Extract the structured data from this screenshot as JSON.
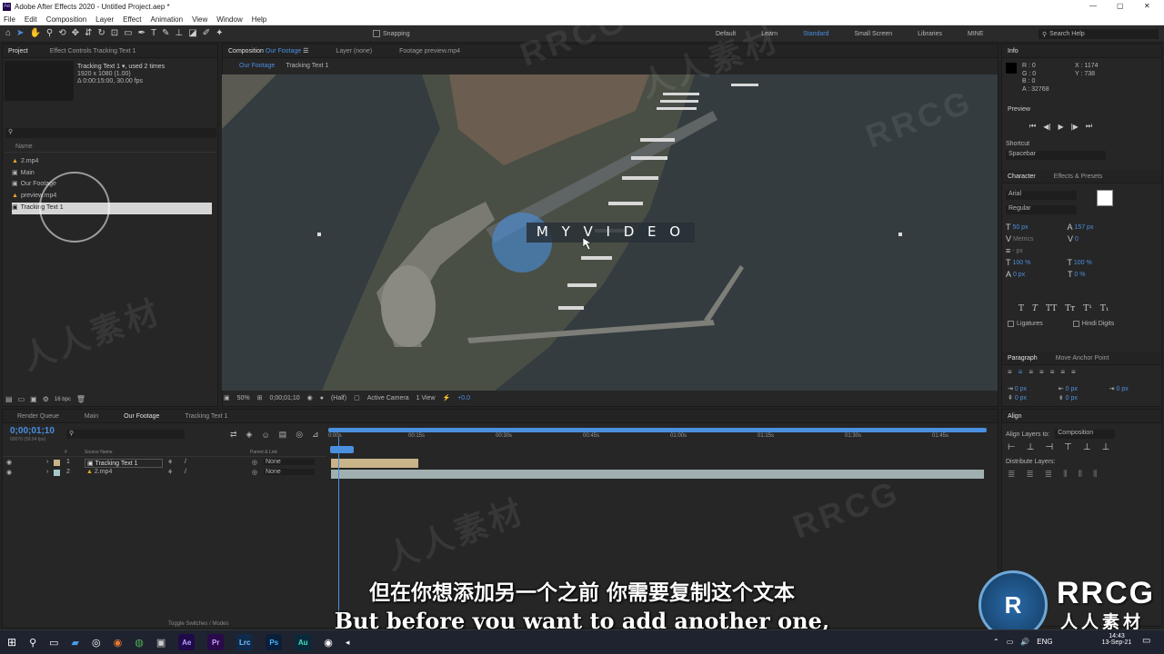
{
  "window": {
    "title": "Adobe After Effects 2020 - Untitled Project.aep *",
    "min": "—",
    "max": "▢",
    "close": "✕"
  },
  "menu": [
    "File",
    "Edit",
    "Composition",
    "Layer",
    "Effect",
    "Animation",
    "View",
    "Window",
    "Help"
  ],
  "toolbar": {
    "snapping": "Snapping",
    "workspaces": [
      "Default",
      "Learn",
      "Standard",
      "Small Screen",
      "Libraries",
      "MINE"
    ],
    "active_workspace": "Standard",
    "search_placeholder": "Search Help"
  },
  "project": {
    "tab": "Project",
    "effect_tab": "Effect Controls Tracking Text 1",
    "selected_name": "Tracking Text 1",
    "used": ", used 2 times",
    "dims": "1920 x 1080 (1.00)",
    "duration": "Δ 0:00:15:00, 30.00 fps",
    "col_name": "Name",
    "items": [
      "2.mp4",
      "Main",
      "Our Footage",
      "preview.mp4",
      "Tracking Text 1"
    ],
    "bpc": "16 bpc"
  },
  "comp": {
    "tab_label": "Composition",
    "tab_name": "Our Footage",
    "layer_tab": "Layer (none)",
    "footage_tab": "Footage preview.mp4",
    "crumb1": "Our Footage",
    "crumb2": "Tracking Text 1",
    "overlay_text": "M Y  V I D E O",
    "zoom": "50%",
    "time": "0;00;01;10",
    "res": "(Half)",
    "camera": "Active Camera",
    "view": "1 View",
    "exposure": "+0.0"
  },
  "info": {
    "tab": "Info",
    "r": "R : 0",
    "g": "G : 0",
    "b": "B : 0",
    "a": "A : 32768",
    "x": "X : 1174",
    "y": "Y : 738"
  },
  "preview": {
    "tab": "Preview",
    "shortcut_label": "Shortcut",
    "shortcut_value": "Spacebar"
  },
  "character": {
    "tab": "Character",
    "tab2": "Effects & Presets",
    "font": "Arial",
    "style": "Regular",
    "size": "50 px",
    "leading": "157 px",
    "kerning": "Metrics",
    "tracking": "0",
    "stroke_unit": "- px",
    "vscale": "100 %",
    "hscale": "100 %",
    "baseline": "0 px",
    "tsume": "0 %",
    "ligatures": "Ligatures",
    "hindi": "Hindi Digits"
  },
  "paragraph": {
    "tab": "Paragraph",
    "tab2": "Move Anchor Point",
    "i1": "0 px",
    "i2": "0 px",
    "i3": "0 px",
    "i4": "0 px",
    "i5": "0 px"
  },
  "align": {
    "tab": "Align",
    "align_to_label": "Align Layers to:",
    "align_to": "Composition",
    "distribute": "Distribute Layers:"
  },
  "timeline": {
    "tabs": [
      "Render Queue",
      "Main",
      "Our Footage",
      "Tracking Text 1"
    ],
    "active_tab": "Our Footage",
    "timecode": "0;00;01;10",
    "frames": "00070 (59.94 fps)",
    "cols": {
      "num": "#",
      "source": "Source Name",
      "parent": "Parent & Link"
    },
    "layers": [
      {
        "num": "1",
        "name": "Tracking Text 1",
        "parent": "None"
      },
      {
        "num": "2",
        "name": "2.mp4",
        "parent": "None"
      }
    ],
    "ruler": [
      "0:00s",
      "00:15s",
      "00:30s",
      "00:45s",
      "01:00s",
      "01:15s",
      "01:30s",
      "01:45s"
    ],
    "toggle": "Toggle Switches / Modes"
  },
  "subtitles": {
    "zh": "但在你想添加另一个之前 你需要复制这个文本",
    "en": "But before you want to add another one,"
  },
  "watermark": {
    "brand": "RRCG",
    "brand_cn": "人人素材",
    "wm": "RRCG",
    "wm_cn": "人人素材"
  },
  "taskbar": {
    "lang": "ENG",
    "time": "14:43",
    "date": "13-Sep-21",
    "apps": [
      "Ae",
      "Pr",
      "Lrc",
      "Ps",
      "Au"
    ]
  },
  "colors": {
    "accent": "#4a8fe0",
    "ae": "#1f0a4a",
    "pr": "#2a0a4a",
    "lrc": "#0f2a4a",
    "ps": "#0a1f3a",
    "au": "#0a2a3a"
  }
}
